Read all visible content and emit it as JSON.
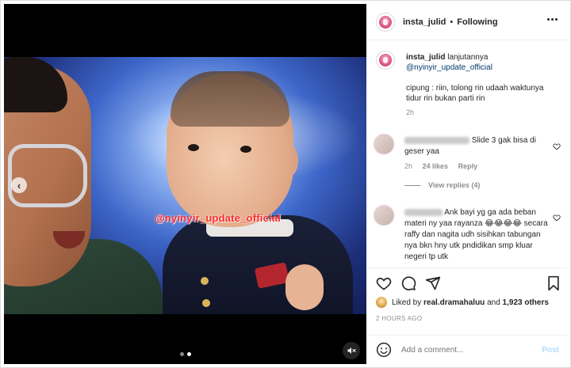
{
  "post": {
    "username": "insta_julid",
    "separator": "•",
    "follow_status": "Following"
  },
  "caption": {
    "username": "insta_julid",
    "text": "lanjutannya",
    "mention": "@nyinyir_update_official",
    "quote": "cipung : riin, tolong rin udaah waktunya tidur rin bukan parti rin",
    "time": "2h"
  },
  "media": {
    "watermark": "@nyinyir_update_official",
    "dots": 2,
    "active_dot": 1
  },
  "comments": [
    {
      "text": "Slide 3 gak bisa di geser yaa",
      "time": "2h",
      "likes": "24 likes",
      "reply": "Reply",
      "view_replies": "View replies (4)"
    },
    {
      "text": "Ank bayi yg ga ada beban materi ny yaa rayanza 😂😂😂😂 secara raffy dan nagita udh sisihkan tabungan nya bkn hny utk pndidikan smp kluar negeri tp utk"
    }
  ],
  "likes": {
    "prefix": "Liked by",
    "user": "real.dramahaluu",
    "suffix": "and",
    "others": "1,923 others"
  },
  "timestamp": "2 HOURS AGO",
  "add_comment": {
    "placeholder": "Add a comment...",
    "post_label": "Post"
  },
  "colors": {
    "link": "#00376b",
    "muted": "#8e8e8e",
    "post_disabled": "#b2dffc",
    "watermark": "#ff2a2a"
  },
  "icons": [
    "more-icon",
    "heart-icon",
    "comment-icon",
    "share-icon",
    "bookmark-icon",
    "emoji-icon",
    "mute-icon",
    "chevron-left-icon"
  ]
}
